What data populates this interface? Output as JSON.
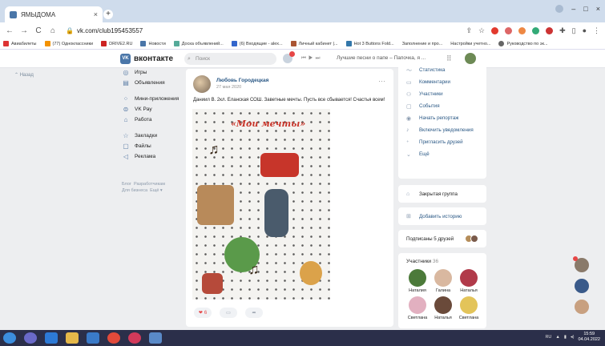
{
  "browser": {
    "tab_title": "ЯМЫДОМА",
    "new_tab": "+",
    "url": "vk.com/club195453557",
    "bookmarks": [
      "Авиабилеты",
      "(77) Одноклассники",
      "DRIVE2.RU",
      "Новости",
      "Доска объявлений...",
      "(6) Входящие - alex...",
      "Личный кабинет |...",
      "Hot 3 Buttons Fold...",
      "Заполнение и про...",
      "Настройки учетно...",
      "Руководство по эк..."
    ]
  },
  "vk": {
    "logo": "вконтакте",
    "logo_badge": "VK",
    "search_placeholder": "Поиск",
    "song": "Лучшие песни о папе – Папочка, я ...",
    "back_link": "Назад"
  },
  "menu": {
    "items": [
      "Игры",
      "Объявления",
      "Мини-приложения",
      "VK Pay",
      "Работа",
      "Закладки",
      "Файлы",
      "Реклама"
    ],
    "footer": [
      "Блог",
      "Разработчикам",
      "Для бизнеса",
      "Ещё ▾"
    ]
  },
  "post": {
    "author": "Любовь Городецкая",
    "date": "27 мая 2020",
    "text": "Даниил В. 2кл. Еланская СОШ. Заветные мечты. Пусть все сбывается! Счастья всем!",
    "image_title": "«Мои мечты»",
    "likes": "6"
  },
  "admin_menu": {
    "items": [
      "Статистика",
      "Комментарии",
      "Участники",
      "События",
      "Начать репортаж",
      "Включить уведомления",
      "Пригласить друзей",
      "Ещё"
    ]
  },
  "group": {
    "closed_label": "Закрытая группа",
    "add_story": "Добавить историю",
    "friends_label": "Подписаны 5 друзей",
    "members_title": "Участники",
    "members_count": "36",
    "members": [
      "Наталия",
      "Галина",
      "Наталья",
      "Светлана",
      "Наталья",
      "Светлана"
    ]
  },
  "taskbar": {
    "lang": "RU",
    "time": "15:59",
    "date": "04.04.2022"
  },
  "colors": {
    "vk_blue": "#4a76a8",
    "link": "#2a5885",
    "bg": "#edeef0"
  }
}
